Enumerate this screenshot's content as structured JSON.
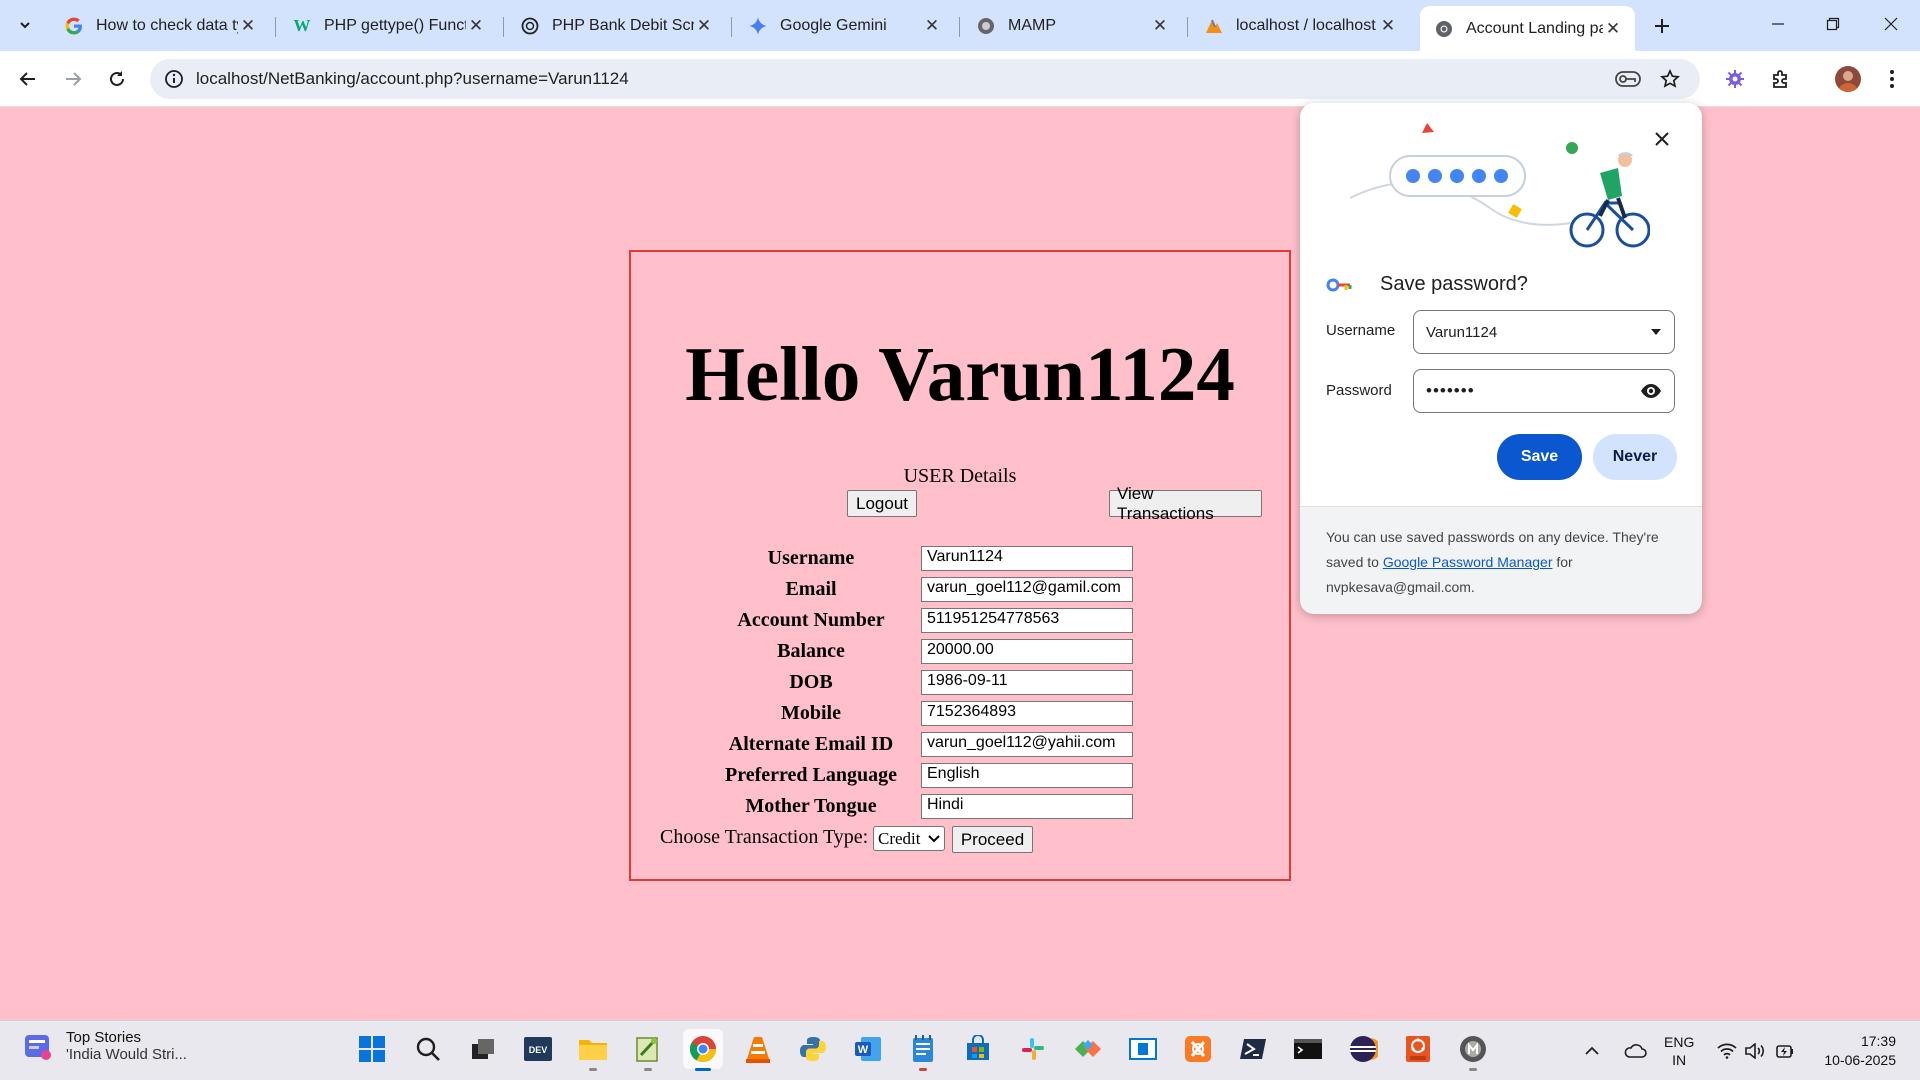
{
  "browser": {
    "tabs": [
      {
        "title": "How to check data ty",
        "icon": "google-icon",
        "active": false
      },
      {
        "title": "PHP gettype() Functio",
        "icon": "w3-icon",
        "active": false
      },
      {
        "title": "PHP Bank Debit Scrip",
        "icon": "chatgpt-icon",
        "active": false
      },
      {
        "title": "Google Gemini",
        "icon": "gemini-icon",
        "active": false
      },
      {
        "title": "MAMP",
        "icon": "mamp-icon",
        "active": false
      },
      {
        "title": "localhost / localhost",
        "icon": "phpmyadmin-icon",
        "active": false
      },
      {
        "title": "Account Landing pag",
        "icon": "chrome-icon",
        "active": true
      }
    ],
    "url": "localhost/NetBanking/account.php?username=Varun1124"
  },
  "page": {
    "greeting": "Hello Varun1124",
    "section_title": "USER Details",
    "logout_label": "Logout",
    "view_transactions_label": "View Transactions",
    "fields": [
      {
        "label": "Username",
        "value": "Varun1124"
      },
      {
        "label": "Email",
        "value": "varun_goel112@gamil.com"
      },
      {
        "label": "Account Number",
        "value": "511951254778563"
      },
      {
        "label": "Balance",
        "value": "20000.00"
      },
      {
        "label": "DOB",
        "value": "1986-09-11"
      },
      {
        "label": "Mobile",
        "value": "7152364893"
      },
      {
        "label": "Alternate Email ID",
        "value": "varun_goel112@yahii.com"
      },
      {
        "label": "Preferred Language",
        "value": "English"
      },
      {
        "label": "Mother Tongue",
        "value": "Hindi"
      }
    ],
    "transaction_label": "Choose Transaction Type:",
    "transaction_type": "Credit",
    "proceed_label": "Proceed",
    "border_color": "#e53935",
    "background_color": "#ffc0cb"
  },
  "password_bubble": {
    "title": "Save password?",
    "username_label": "Username",
    "username_value": "Varun1124",
    "password_label": "Password",
    "password_value": "•••••••",
    "save_label": "Save",
    "never_label": "Never",
    "footer_text_1": "You can use saved passwords on any device. They're saved to ",
    "footer_link": "Google Password Manager",
    "footer_text_2": " for nvpkesava@gmail.com.",
    "accent_color": "#0b57d0"
  },
  "taskbar": {
    "news_title": "Top Stories",
    "news_subtitle": "'India Would Stri...",
    "lang_line1": "ENG",
    "lang_line2": "IN",
    "time": "17:39",
    "date": "10-06-2025"
  }
}
